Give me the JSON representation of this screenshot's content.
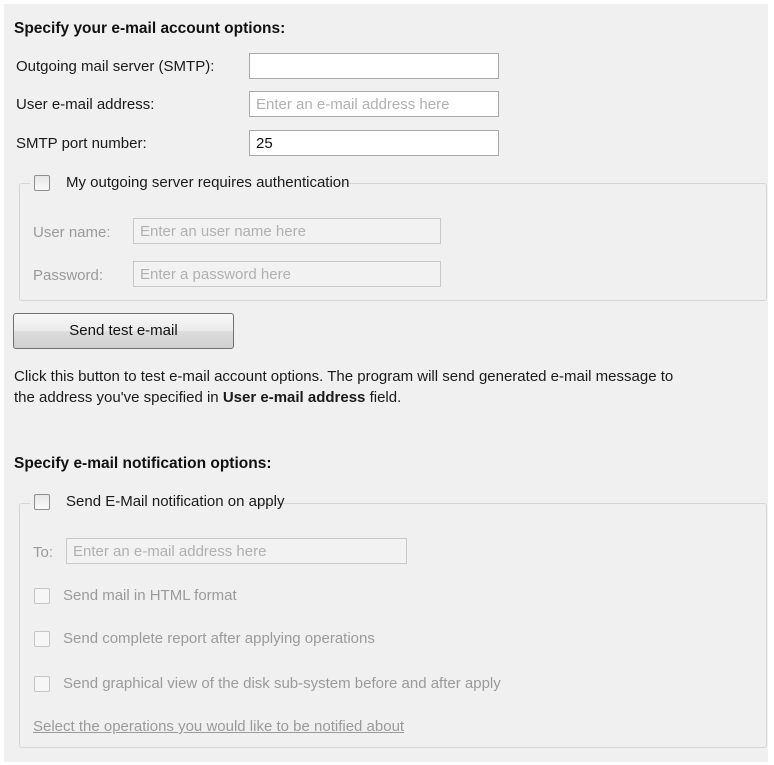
{
  "account": {
    "title": "Specify your e-mail account options:",
    "smtp_label": "Outgoing mail server (SMTP):",
    "smtp_value": "",
    "email_label": "User e-mail address:",
    "email_placeholder": "Enter an e-mail address here",
    "port_label": "SMTP port number:",
    "port_value": "25",
    "auth_checkbox_label": "My outgoing server requires authentication",
    "auth_checked": false,
    "username_label": "User name:",
    "username_placeholder": "Enter an user name here",
    "password_label": "Password:",
    "password_placeholder": "Enter a password here",
    "test_button_label": "Send test e-mail",
    "description_part1": "Click this button to test e-mail account options. The program will send generated e-mail message to",
    "description_part2": "the address you've specified in ",
    "description_bold": "User e-mail address",
    "description_part3": " field."
  },
  "notification": {
    "title": "Specify e-mail notification options:",
    "apply_checkbox_label": "Send E-Mail notification on apply",
    "apply_checked": false,
    "to_label": "To:",
    "to_placeholder": "Enter an e-mail address here",
    "html_label": "Send mail in HTML format",
    "report_label": "Send complete report after applying operations",
    "graphical_label": "Send graphical view of the disk sub-system before and after apply",
    "operations_link": "Select the operations you would like to be notified about"
  }
}
